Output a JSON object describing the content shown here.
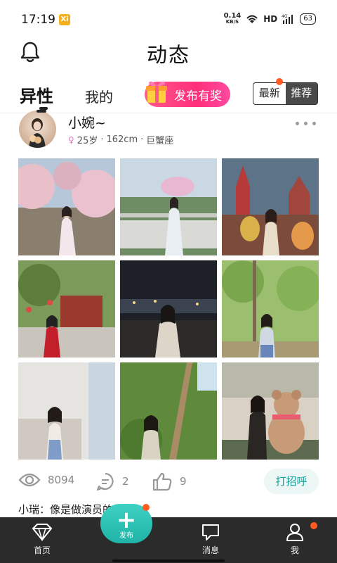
{
  "status_bar": {
    "time": "17:19",
    "app_badge": "Xi",
    "net_speed_value": "0.14",
    "net_speed_unit": "KB/S",
    "hd": "HD",
    "signal": "4G",
    "battery": "63"
  },
  "header": {
    "title": "动态"
  },
  "tabs": {
    "active": "异性",
    "mine": "我的",
    "promo": "发布有奖",
    "sort_latest": "最新",
    "sort_recommend": "推荐"
  },
  "post": {
    "username": "小婉~",
    "age": "25岁",
    "height": "162cm",
    "zodiac": "巨蟹座",
    "photo_count": 9,
    "stats": {
      "views": "8094",
      "comments": "2",
      "likes": "9"
    },
    "greet_button": "打招呼",
    "comment_preview": "小瑞：像是做演员的"
  },
  "bottom_nav": {
    "home": "首页",
    "publish": "发布",
    "messages": "消息",
    "me": "我"
  },
  "colors": {
    "accent": "#1fb4a7",
    "promo": "#ff2e7a",
    "notify": "#ff5a1f",
    "nav_bg": "#2b2b2b"
  }
}
